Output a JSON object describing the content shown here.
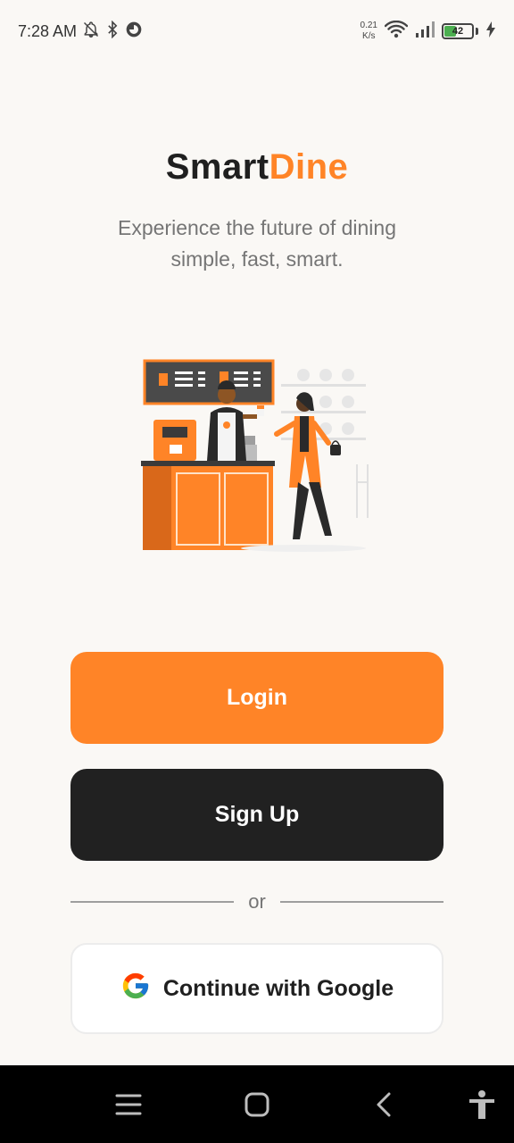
{
  "status_bar": {
    "time": "7:28 AM",
    "net_speed_value": "0.21",
    "net_speed_unit": "K/s",
    "battery_level": "42",
    "icons": [
      "alarm-off-icon",
      "bluetooth-icon",
      "app-notification-icon",
      "wifi-icon",
      "signal-icon",
      "battery-icon",
      "charging-icon"
    ]
  },
  "brand": {
    "part1": "Smart",
    "part2": "Dine",
    "part1_color": "#1f1f1f",
    "part2_color": "#ff8427"
  },
  "tagline": {
    "line1": "Experience the future of dining",
    "line2": "simple, fast, smart."
  },
  "illustration": {
    "icon": "cafe-barista-illustration"
  },
  "buttons": {
    "login": "Login",
    "signup": "Sign Up",
    "google": "Continue with Google"
  },
  "divider": {
    "label": "or"
  },
  "colors": {
    "accent": "#ff8427",
    "dark": "#212121",
    "background": "#faf8f5"
  },
  "nav_bar": {
    "icons": [
      "menu-icon",
      "home-icon",
      "back-icon",
      "accessibility-icon"
    ]
  }
}
